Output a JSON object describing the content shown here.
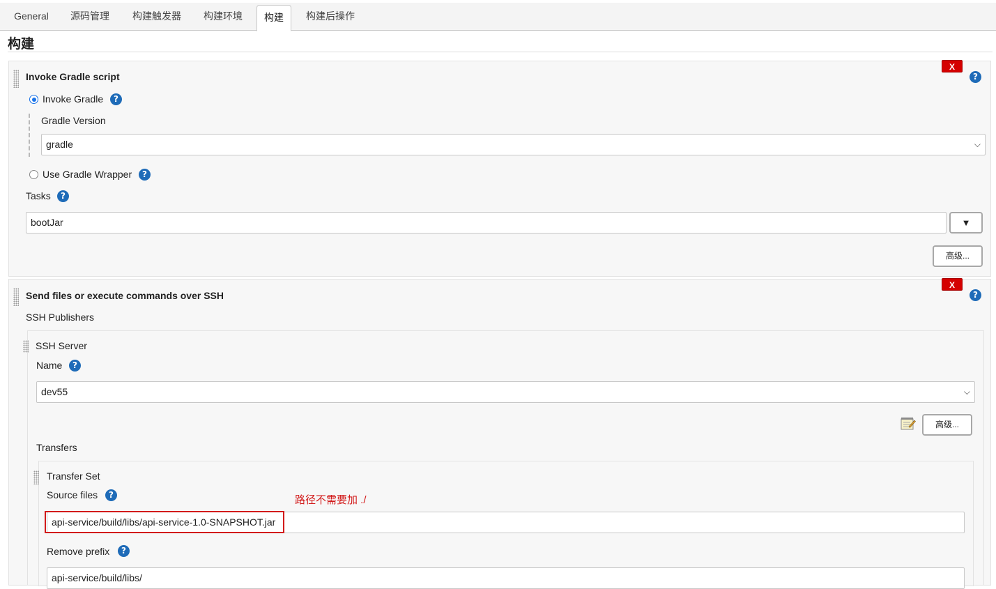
{
  "tabs": [
    "General",
    "源码管理",
    "构建触发器",
    "构建环境",
    "构建",
    "构建后操作"
  ],
  "active_tab": "构建",
  "section_title": "构建",
  "gradle": {
    "title": "Invoke Gradle script",
    "delete_label": "X",
    "help": "?",
    "invoke_gradle_label": "Invoke Gradle",
    "invoke_gradle_checked": true,
    "gradle_version_label": "Gradle Version",
    "gradle_version_value": "gradle",
    "use_wrapper_label": "Use Gradle Wrapper",
    "use_wrapper_checked": false,
    "tasks_label": "Tasks",
    "tasks_value": "bootJar",
    "tasks_expand": "▼",
    "advanced_label": "高级..."
  },
  "ssh": {
    "title": "Send files or execute commands over SSH",
    "delete_label": "X",
    "publishers_label": "SSH Publishers",
    "server": {
      "title": "SSH Server",
      "name_label": "Name",
      "name_value": "dev55",
      "advanced_label": "高级...",
      "transfers_label": "Transfers",
      "transfer_set": {
        "title": "Transfer Set",
        "source_files_label": "Source files",
        "source_files_value": "api-service/build/libs/api-service-1.0-SNAPSHOT.jar",
        "remove_prefix_label": "Remove prefix",
        "remove_prefix_value": "api-service/build/libs/"
      }
    }
  },
  "annotation": {
    "text": "路径不需要加 ./",
    "color": "#d21a1a"
  },
  "colors": {
    "help_blue": "#1e6bb8",
    "delete_red": "#d40000",
    "panel_bg": "#f7f7f7"
  }
}
